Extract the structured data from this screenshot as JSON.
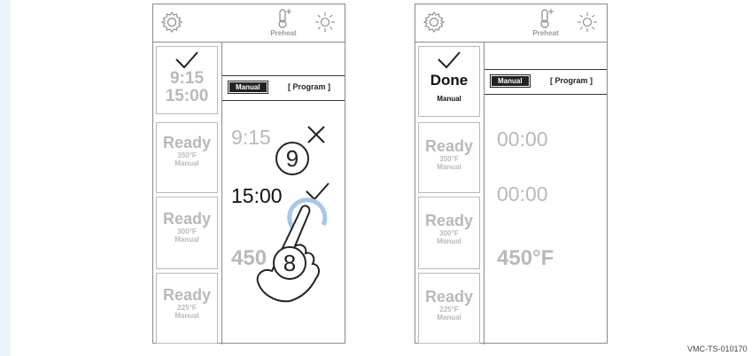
{
  "left_device": {
    "preheat_label": "Preheat",
    "slots": [
      {
        "line1": "9:15",
        "line2": "15:00"
      },
      {
        "title": "Ready",
        "temp": "350°F",
        "mode": "Manual"
      },
      {
        "title": "Ready",
        "temp": "300°F",
        "mode": "Manual"
      },
      {
        "title": "Ready",
        "temp": "225°F",
        "mode": "Manual"
      }
    ],
    "mode_manual": "Manual",
    "mode_program": "[ Program ]",
    "start_time": "9:15",
    "end_time": "15:00",
    "temp_partial": "450",
    "callout_top": "9",
    "callout_bottom": "8"
  },
  "right_device": {
    "preheat_label": "Preheat",
    "slots": [
      {
        "title": "Done",
        "mode": "Manual"
      },
      {
        "title": "Ready",
        "temp": "350°F",
        "mode": "Manual"
      },
      {
        "title": "Ready",
        "temp": "300°F",
        "mode": "Manual"
      },
      {
        "title": "Ready",
        "temp": "225°F",
        "mode": "Manual"
      }
    ],
    "mode_manual": "Manual",
    "mode_program": "[ Program ]",
    "start_time": "00:00",
    "end_time": "00:00",
    "temp": "450°F"
  },
  "figure_tag": "VMC-TS-010170",
  "colors": {
    "page_bg": "#eaf2fb",
    "inactive_text": "#b9b9b9",
    "accent_circle": "#a7c6ea"
  }
}
